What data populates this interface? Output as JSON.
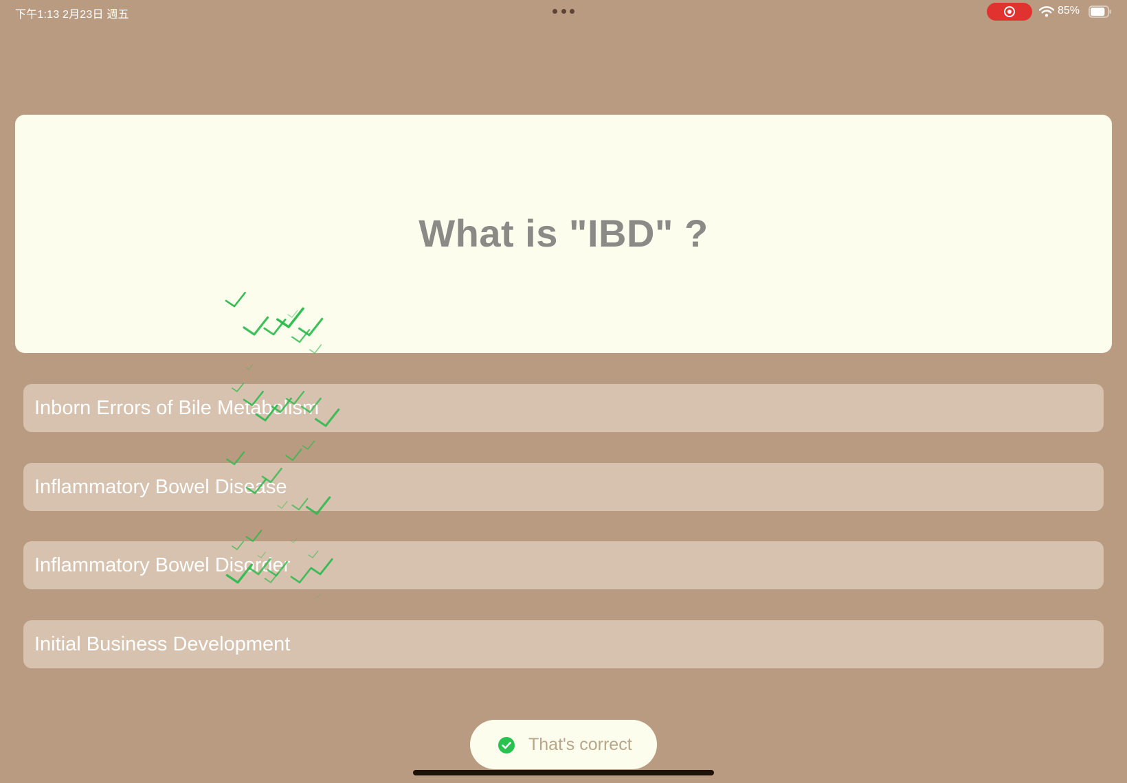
{
  "status_bar": {
    "time": "下午1:13   2月23日 週五",
    "battery": "85%",
    "battery_level": 0.85
  },
  "question": {
    "text": "What is \"IBD\" ?"
  },
  "answers": [
    {
      "label": "Inborn Errors of Bile Metabolism"
    },
    {
      "label": "Inflammatory Bowel Disease"
    },
    {
      "label": "Inflammatory Bowel Disorder"
    },
    {
      "label": "Initial Business Development"
    }
  ],
  "toast": {
    "text": "That's correct"
  },
  "colors": {
    "background": "#b99b82",
    "card": "#fdfdee",
    "answer_bg": "#d6c2ae",
    "success": "#28c24f",
    "record": "#e0322e"
  }
}
